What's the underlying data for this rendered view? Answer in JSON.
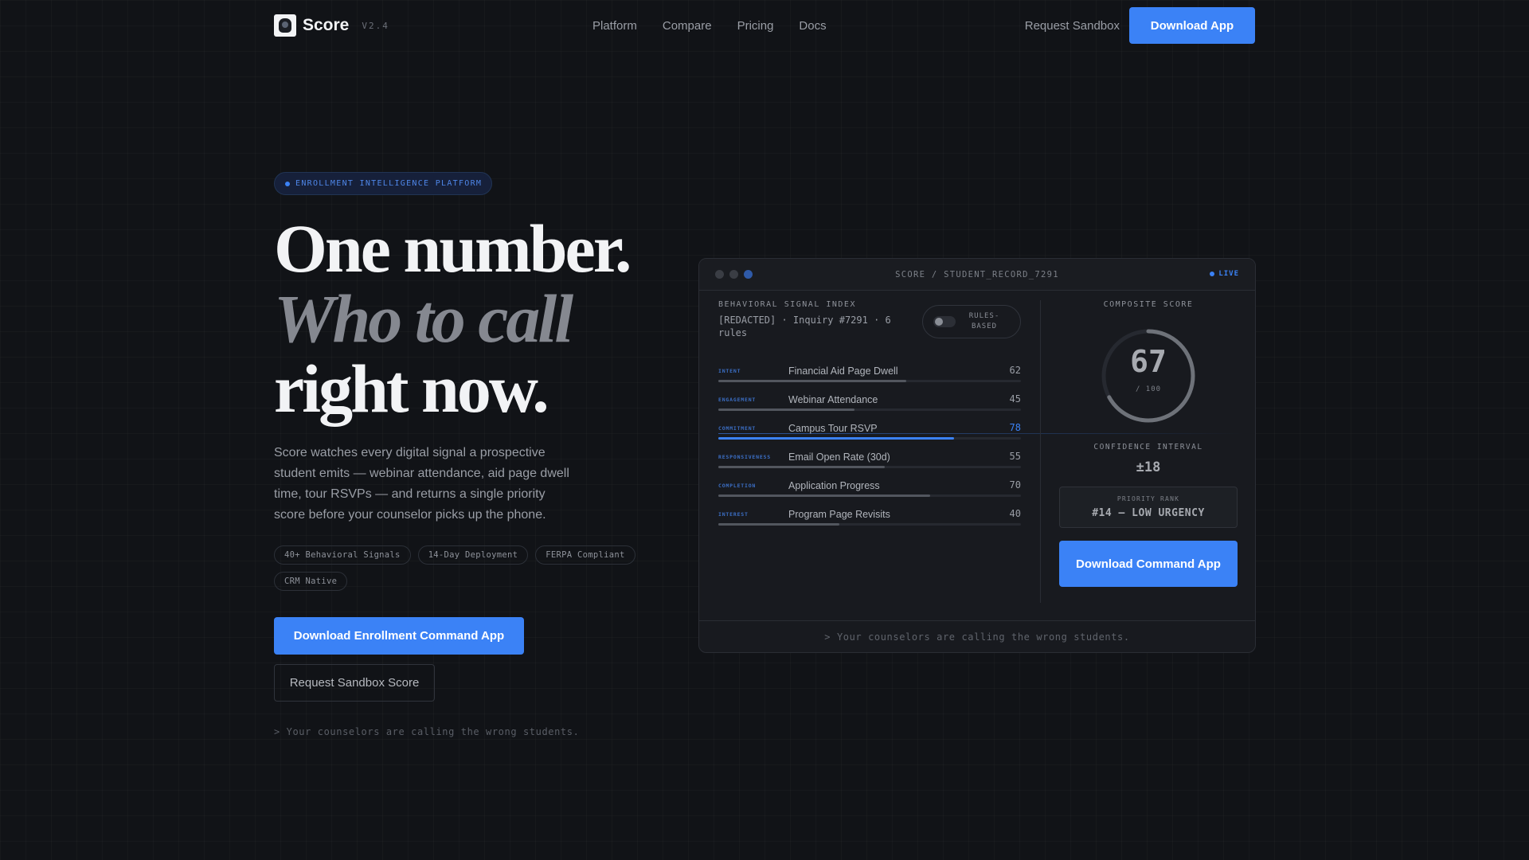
{
  "nav": {
    "brand": "Score",
    "version": "V2.4",
    "links": [
      "Platform",
      "Compare",
      "Pricing",
      "Docs"
    ],
    "request_sandbox": "Request Sandbox",
    "download": "Download App"
  },
  "hero": {
    "eyebrow": "ENROLLMENT INTELLIGENCE PLATFORM",
    "headline": [
      "One number.",
      "Who to call",
      "right now."
    ],
    "description": "Score watches every digital signal a prospective student emits — webinar attendance, aid page dwell time, tour RSVPs — and returns a single priority score before your counselor picks up the phone.",
    "tags": [
      "40+ Behavioral Signals",
      "14-Day Deployment",
      "FERPA Compliant",
      "CRM Native"
    ],
    "cta_primary": "Download Enrollment Command App",
    "cta_secondary": "Request Sandbox Score",
    "prompt": "> Your counselors are calling the wrong students."
  },
  "panel": {
    "title": "SCORE / STUDENT_RECORD_7291",
    "live": "LIVE",
    "section_label": "BEHAVIORAL SIGNAL INDEX",
    "record": "[REDACTED] · Inquiry #7291 · 6 rules",
    "toggle_label": "RULES-BASED",
    "signals": [
      {
        "category": "INTENT",
        "name": "Financial Aid Page Dwell",
        "value": 62,
        "highlight": false
      },
      {
        "category": "ENGAGEMENT",
        "name": "Webinar Attendance",
        "value": 45,
        "highlight": false
      },
      {
        "category": "COMMITMENT",
        "name": "Campus Tour RSVP",
        "value": 78,
        "highlight": true
      },
      {
        "category": "RESPONSIVENESS",
        "name": "Email Open Rate (30d)",
        "value": 55,
        "highlight": false
      },
      {
        "category": "COMPLETION",
        "name": "Application Progress",
        "value": 70,
        "highlight": false
      },
      {
        "category": "INTEREST",
        "name": "Program Page Revisits",
        "value": 40,
        "highlight": false
      }
    ],
    "composite_label": "COMPOSITE SCORE",
    "composite_value": "67",
    "composite_max": "/ 100",
    "composite_fraction": 0.67,
    "ci_label": "CONFIDENCE INTERVAL",
    "ci_value": "±18",
    "rank_label": "PRIORITY RANK",
    "rank_value": "#14 — LOW URGENCY",
    "cta": "Download Command App",
    "footer": "> Your counselors are calling the wrong students."
  },
  "colors": {
    "accent": "#3b82f6",
    "background": "#111317"
  }
}
